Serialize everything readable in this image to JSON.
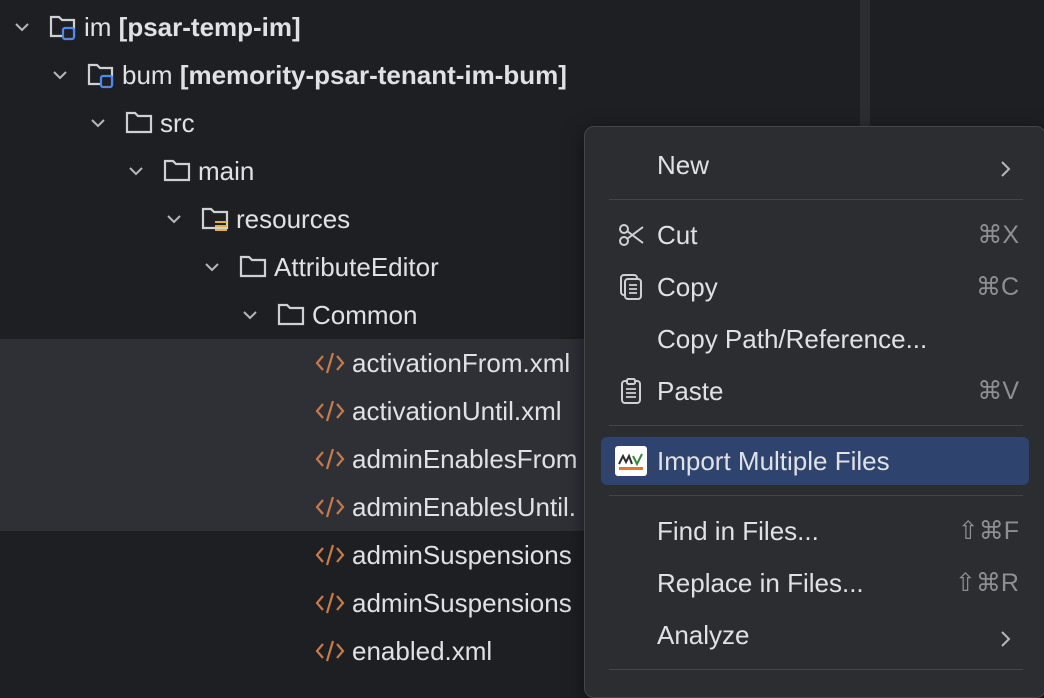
{
  "tree": [
    {
      "name": "im ",
      "bold": "[psar-temp-im]",
      "type": "module"
    },
    {
      "name": "bum ",
      "bold": "[memority-psar-tenant-im-bum]",
      "type": "module"
    },
    {
      "name": "src",
      "type": "folder"
    },
    {
      "name": "main",
      "type": "folder"
    },
    {
      "name": "resources",
      "type": "resources"
    },
    {
      "name": "AttributeEditor",
      "type": "folder"
    },
    {
      "name": "Common",
      "type": "folder"
    },
    {
      "name": "activationFrom.xml",
      "type": "xml"
    },
    {
      "name": "activationUntil.xml",
      "type": "xml"
    },
    {
      "name": "adminEnablesFrom",
      "type": "xml"
    },
    {
      "name": "adminEnablesUntil.",
      "type": "xml"
    },
    {
      "name": "adminSuspensions",
      "type": "xml"
    },
    {
      "name": "adminSuspensions",
      "type": "xml"
    },
    {
      "name": "enabled.xml",
      "type": "xml"
    }
  ],
  "menu": {
    "new": {
      "label": "New"
    },
    "cut": {
      "label": "Cut",
      "shortcut": "⌘X"
    },
    "copy": {
      "label": "Copy",
      "shortcut": "⌘C"
    },
    "copy_path": {
      "label": "Copy Path/Reference..."
    },
    "paste": {
      "label": "Paste",
      "shortcut": "⌘V"
    },
    "import": {
      "label": "Import Multiple Files"
    },
    "find": {
      "label": "Find in Files...",
      "shortcut": "⇧⌘F"
    },
    "replace": {
      "label": "Replace in Files...",
      "shortcut": "⇧⌘R"
    },
    "analyze": {
      "label": "Analyze"
    }
  },
  "colors": {
    "background": "#1e1f22",
    "menu_bg": "#2b2d30",
    "highlight": "#2e436e",
    "selection": "#2e3036",
    "xml_icon": "#c87a4a"
  }
}
